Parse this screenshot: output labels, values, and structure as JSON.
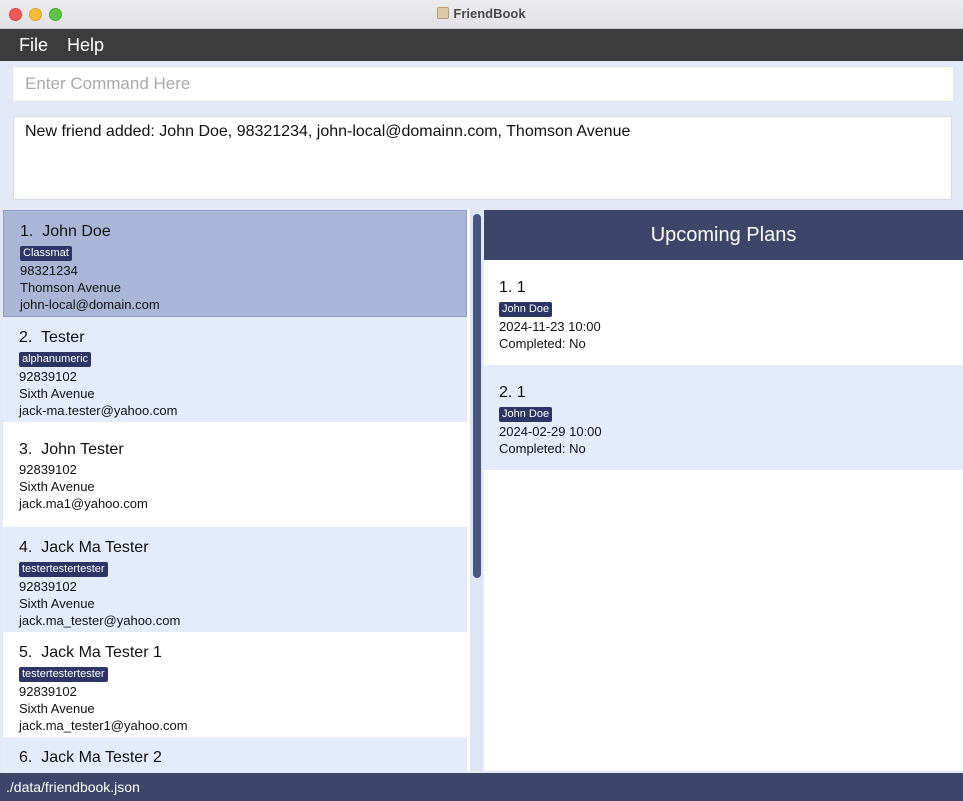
{
  "window": {
    "title": "FriendBook"
  },
  "menu": {
    "file": "File",
    "help": "Help"
  },
  "command": {
    "placeholder": "Enter Command Here",
    "value": ""
  },
  "result": {
    "text": "New friend added: John  Doe, 98321234, john-local@domainn.com, Thomson Avenue"
  },
  "friends": [
    {
      "index": "1.",
      "name": "John Doe",
      "tag": "Classmat",
      "phone": "98321234",
      "address": "Thomson Avenue",
      "email": "john-local@domain.com"
    },
    {
      "index": "2.",
      "name": "Tester",
      "tag": "alphanumeric",
      "phone": "92839102",
      "address": "Sixth Avenue",
      "email": "jack-ma.tester@yahoo.com"
    },
    {
      "index": "3.",
      "name": "John Tester",
      "tag": "",
      "phone": "92839102",
      "address": "Sixth Avenue",
      "email": "jack.ma1@yahoo.com"
    },
    {
      "index": "4.",
      "name": "Jack Ma Tester",
      "tag": "testertestertester",
      "phone": "92839102",
      "address": "Sixth Avenue",
      "email": "jack.ma_tester@yahoo.com"
    },
    {
      "index": "5.",
      "name": "Jack Ma Tester 1",
      "tag": "testertestertester",
      "phone": "92839102",
      "address": "Sixth Avenue",
      "email": "jack.ma_tester1@yahoo.com"
    },
    {
      "index": "6.",
      "name": "Jack Ma Tester 2"
    }
  ],
  "plans": {
    "header": "Upcoming Plans",
    "items": [
      {
        "index": "1.",
        "name": "1",
        "tag": "John Doe",
        "datetime": "2024-11-23 10:00",
        "completed": "Completed: No"
      },
      {
        "index": "2.",
        "name": "1",
        "tag": "John Doe",
        "datetime": "2024-02-29 10:00",
        "completed": "Completed: No"
      }
    ]
  },
  "status": {
    "path": "./data/friendbook.json"
  }
}
